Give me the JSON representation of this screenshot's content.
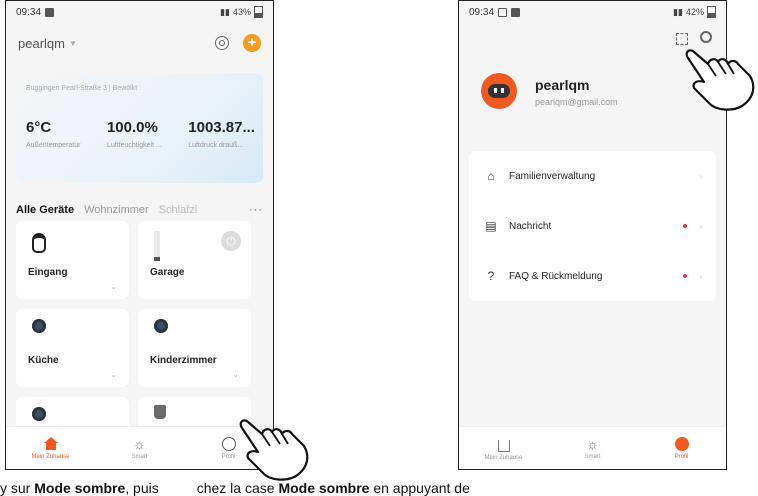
{
  "left_phone": {
    "status": {
      "time": "09:34",
      "signal": "43%"
    },
    "home_name": "pearlqm",
    "weather": {
      "location": "Buggingen Pearl-Straße 3 | Bewölkt",
      "values": [
        {
          "value": "6°C",
          "label": "Außentemperatur"
        },
        {
          "value": "100.0%",
          "label": "Luftfeuchtigkeit ..."
        },
        {
          "value": "1003.87...",
          "label": "Luftdruck drauß..."
        }
      ]
    },
    "tabs": {
      "active": "Alle Geräte",
      "second": "Wohnzimmer",
      "third": "Schlafzi",
      "more": "···"
    },
    "devices": [
      {
        "name": "Eingang",
        "icon": "camera-icon"
      },
      {
        "name": "Garage",
        "icon": "lamp-icon"
      },
      {
        "name": "Küche",
        "icon": "dome-camera-icon"
      },
      {
        "name": "Kinderzimmer",
        "icon": "dome-camera-icon"
      },
      {
        "name": "",
        "icon": "dome-camera-icon"
      },
      {
        "name": "",
        "icon": "device-icon"
      }
    ],
    "tabbar": {
      "home": "Mein Zuhause",
      "smart": "Smart",
      "profile": "Profil"
    }
  },
  "right_phone": {
    "status": {
      "time": "09:34",
      "signal": "42%"
    },
    "profile": {
      "name": "pearlqm",
      "email": "pearlqm@gmail.com"
    },
    "menu": [
      {
        "label": "Familienverwaltung",
        "icon": "house-icon",
        "dot": false
      },
      {
        "label": "Nachricht",
        "icon": "message-icon",
        "dot": true
      },
      {
        "label": "FAQ & Rückmeldung",
        "icon": "question-icon",
        "dot": true
      }
    ],
    "tabbar": {
      "home": "Mein Zuhause",
      "smart": "Smart",
      "profile": "Profil"
    }
  },
  "caption": {
    "part1": "y sur ",
    "bold1": "Mode sombre",
    "part2": ", puis",
    "part3": "chez la case ",
    "bold2": "Mode sombre",
    "part4": " en appuyant de"
  },
  "colors": {
    "accent": "#f05a22",
    "plus": "#f59a23",
    "dot": "#e8304a"
  }
}
